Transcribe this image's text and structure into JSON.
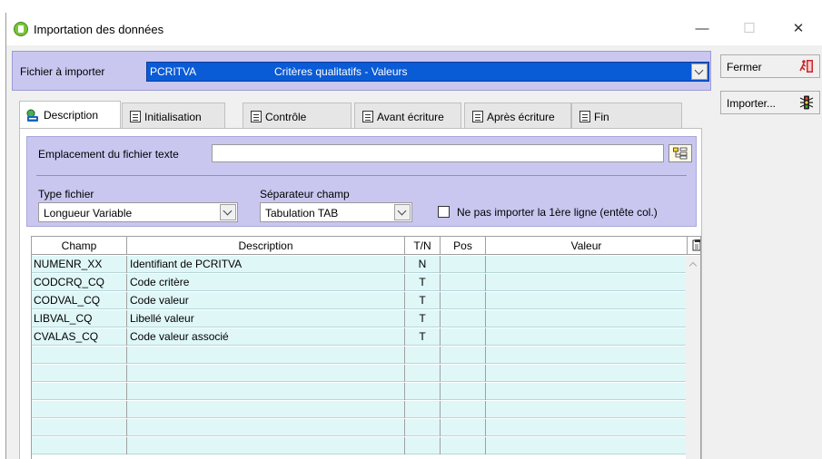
{
  "window": {
    "title": "Importation des données"
  },
  "file": {
    "label": "Fichier à importer",
    "code": "PCRITVA",
    "description": "Critères qualitatifs - Valeurs"
  },
  "actions": {
    "close_label": "Fermer",
    "import_label": "Importer..."
  },
  "tabs": [
    {
      "label": "Description",
      "icon": "description-icon"
    },
    {
      "label": "Initialisation",
      "icon": "document-icon"
    },
    {
      "label": "Contrôle",
      "icon": "document-icon"
    },
    {
      "label": "Avant écriture",
      "icon": "document-icon"
    },
    {
      "label": "Après écriture",
      "icon": "document-icon"
    },
    {
      "label": "Fin",
      "icon": "document-icon"
    }
  ],
  "description": {
    "location_label": "Emplacement du fichier texte",
    "location_value": "",
    "type_label": "Type fichier",
    "type_value": "Longueur Variable",
    "separator_label": "Séparateur champ",
    "separator_value": "Tabulation TAB",
    "skip_header_label": "Ne pas importer la 1ère ligne (entête col.)",
    "skip_header_checked": false
  },
  "grid": {
    "columns": [
      "Champ",
      "Description",
      "T/N",
      "Pos",
      "Valeur"
    ],
    "rows": [
      {
        "champ": "NUMENR_XX",
        "description": "Identifiant de PCRITVA",
        "tn": "N",
        "pos": "",
        "valeur": ""
      },
      {
        "champ": "CODCRQ_CQ",
        "description": "Code critère",
        "tn": "T",
        "pos": "",
        "valeur": ""
      },
      {
        "champ": "CODVAL_CQ",
        "description": "Code valeur",
        "tn": "T",
        "pos": "",
        "valeur": ""
      },
      {
        "champ": "LIBVAL_CQ",
        "description": "Libellé valeur",
        "tn": "T",
        "pos": "",
        "valeur": ""
      },
      {
        "champ": "CVALAS_CQ",
        "description": "Code valeur associé",
        "tn": "T",
        "pos": "",
        "valeur": ""
      },
      {
        "champ": "",
        "description": "",
        "tn": "",
        "pos": "",
        "valeur": ""
      },
      {
        "champ": "",
        "description": "",
        "tn": "",
        "pos": "",
        "valeur": ""
      },
      {
        "champ": "",
        "description": "",
        "tn": "",
        "pos": "",
        "valeur": ""
      },
      {
        "champ": "",
        "description": "",
        "tn": "",
        "pos": "",
        "valeur": ""
      },
      {
        "champ": "",
        "description": "",
        "tn": "",
        "pos": "",
        "valeur": ""
      },
      {
        "champ": "",
        "description": "",
        "tn": "",
        "pos": "",
        "valeur": ""
      }
    ]
  },
  "colors": {
    "selection": "#0a5bd6",
    "panel": "#c9c7f0",
    "row": "#e0f7f8"
  }
}
